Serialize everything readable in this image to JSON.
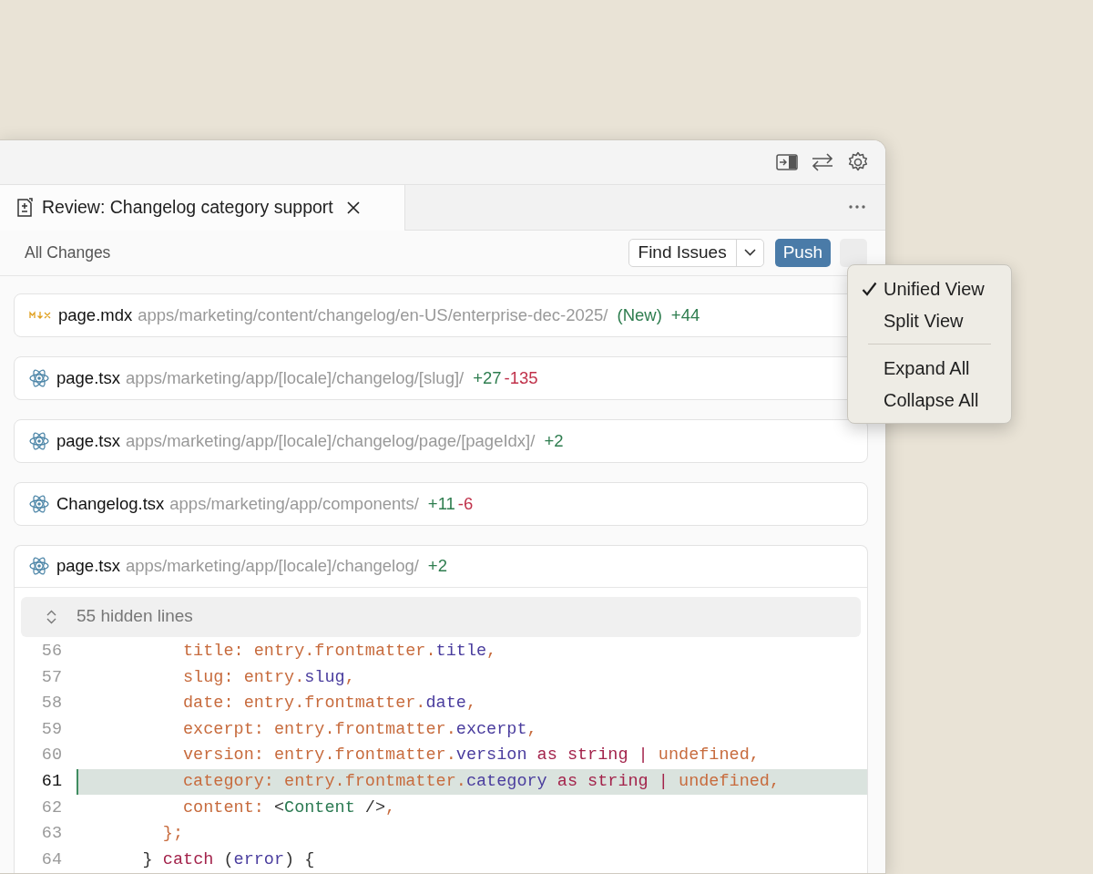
{
  "tab": {
    "title": "Review: Changelog category support",
    "selected": true
  },
  "toolbar": {
    "label": "All Changes",
    "find_button": "Find Issues",
    "push_button": "Push"
  },
  "files": [
    {
      "kind": "mdx",
      "name": "page.mdx",
      "path": "apps/marketing/content/changelog/en-US/enterprise-dec-2025/",
      "status": "(New)",
      "additions": "+44",
      "expanded": false
    },
    {
      "kind": "react",
      "name": "page.tsx",
      "path": "apps/marketing/app/[locale]/changelog/[slug]/",
      "additions": "+27",
      "deletions": "-135",
      "expanded": false
    },
    {
      "kind": "react",
      "name": "page.tsx",
      "path": "apps/marketing/app/[locale]/changelog/page/[pageIdx]/",
      "additions": "+2",
      "expanded": false
    },
    {
      "kind": "react",
      "name": "Changelog.tsx",
      "path": "apps/marketing/app/components/",
      "additions": "+11",
      "deletions": "-6",
      "expanded": false
    },
    {
      "kind": "react",
      "name": "page.tsx",
      "path": "apps/marketing/app/[locale]/changelog/",
      "additions": "+2",
      "expanded": true,
      "hidden_lines": "55 hidden lines",
      "lines": [
        {
          "number": "56",
          "added": false,
          "tokens": [
            {
              "kind": "ident",
              "text": "          title: entry.frontmatter."
            },
            {
              "kind": "member",
              "text": "title"
            },
            {
              "kind": "ident",
              "text": ","
            }
          ]
        },
        {
          "number": "57",
          "added": false,
          "tokens": [
            {
              "kind": "ident",
              "text": "          slug: entry."
            },
            {
              "kind": "member",
              "text": "slug"
            },
            {
              "kind": "ident",
              "text": ","
            }
          ]
        },
        {
          "number": "58",
          "added": false,
          "tokens": [
            {
              "kind": "ident",
              "text": "          date: entry.frontmatter."
            },
            {
              "kind": "member",
              "text": "date"
            },
            {
              "kind": "ident",
              "text": ","
            }
          ]
        },
        {
          "number": "59",
          "added": false,
          "tokens": [
            {
              "kind": "ident",
              "text": "          excerpt: entry.frontmatter."
            },
            {
              "kind": "member",
              "text": "excerpt"
            },
            {
              "kind": "ident",
              "text": ","
            }
          ]
        },
        {
          "number": "60",
          "added": false,
          "tokens": [
            {
              "kind": "ident",
              "text": "          version: entry.frontmatter."
            },
            {
              "kind": "member",
              "text": "version"
            },
            {
              "kind": "keyword",
              "text": " as string | "
            },
            {
              "kind": "ident",
              "text": "undefined,"
            }
          ]
        },
        {
          "number": "61",
          "added": true,
          "tokens": [
            {
              "kind": "ident",
              "text": "          category: entry.frontmatter."
            },
            {
              "kind": "member",
              "text": "category"
            },
            {
              "kind": "keyword",
              "text": " as string | "
            },
            {
              "kind": "ident",
              "text": "undefined,"
            }
          ]
        },
        {
          "number": "62",
          "added": false,
          "tokens": [
            {
              "kind": "ident",
              "text": "          content: "
            },
            {
              "kind": "punct",
              "text": "<"
            },
            {
              "kind": "tag",
              "text": "Content"
            },
            {
              "kind": "punct",
              "text": " />"
            },
            {
              "kind": "ident",
              "text": ","
            }
          ]
        },
        {
          "number": "63",
          "added": false,
          "tokens": [
            {
              "kind": "ident",
              "text": "        };"
            }
          ]
        },
        {
          "number": "64",
          "added": false,
          "tokens": [
            {
              "kind": "punct",
              "text": "      } "
            },
            {
              "kind": "keyword",
              "text": "catch"
            },
            {
              "kind": "punct",
              "text": " ("
            },
            {
              "kind": "member",
              "text": "error"
            },
            {
              "kind": "punct",
              "text": ") {"
            }
          ]
        }
      ]
    }
  ],
  "menu": [
    {
      "kind": "option",
      "label": "Unified View",
      "checked": true
    },
    {
      "kind": "option",
      "label": "Split View",
      "checked": false
    },
    {
      "kind": "separator"
    },
    {
      "kind": "action",
      "label": "Expand All"
    },
    {
      "kind": "action",
      "label": "Collapse All"
    }
  ]
}
